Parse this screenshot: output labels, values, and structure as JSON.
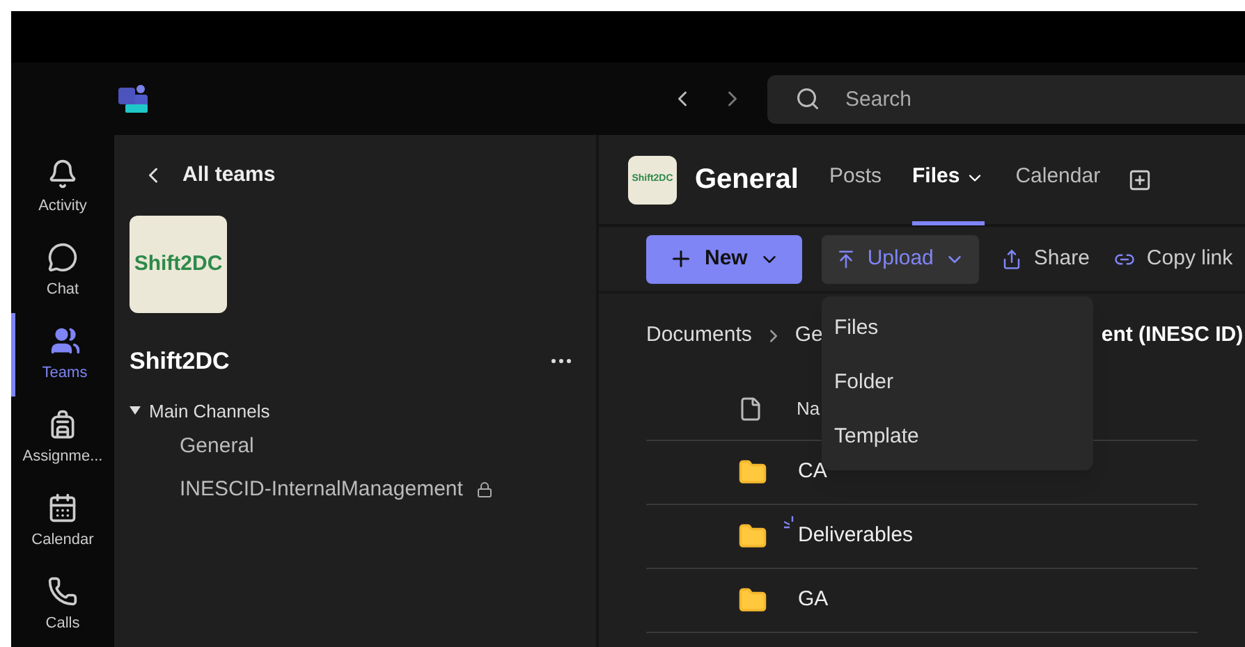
{
  "top_bar": {
    "search": {
      "placeholder": "Search"
    }
  },
  "rail": [
    {
      "label": "Activity",
      "kind": "bell",
      "selected": false
    },
    {
      "label": "Chat",
      "kind": "chat",
      "selected": false
    },
    {
      "label": "Teams",
      "kind": "teams",
      "selected": true
    },
    {
      "label": "Assignme...",
      "kind": "backpack",
      "selected": false
    },
    {
      "label": "Calendar",
      "kind": "calendar",
      "selected": false
    },
    {
      "label": "Calls",
      "kind": "phone",
      "selected": false
    }
  ],
  "team_panel": {
    "back": "All teams",
    "team_name": "Shift2DC",
    "logo_text": "Shift2DC",
    "group": {
      "label": "Main Channels",
      "expanded": true,
      "channels": [
        {
          "name": "General",
          "private": false
        },
        {
          "name": "INESCID-InternalManagement",
          "private": true
        }
      ]
    }
  },
  "channel": {
    "logo_text": "Shift2DC",
    "title": "General",
    "tabs": [
      {
        "label": "Posts",
        "selected": false,
        "dropdown": false
      },
      {
        "label": "Files",
        "selected": true,
        "dropdown": true
      },
      {
        "label": "Calendar",
        "selected": false,
        "dropdown": false
      }
    ]
  },
  "toolbar": [
    {
      "label": "New",
      "kind": "new",
      "selected": false
    },
    {
      "label": "Upload",
      "kind": "upload",
      "selected": true
    },
    {
      "label": "Share",
      "kind": "share",
      "selected": false
    },
    {
      "label": "Copy link",
      "kind": "link",
      "selected": false
    }
  ],
  "breadcrumb": [
    "Documents",
    "Ge",
    "ent (INESC ID)"
  ],
  "upload_menu": [
    "Files",
    "Folder",
    "Template"
  ],
  "files": {
    "column_header": "Na",
    "rows": [
      {
        "name": "CA",
        "syncing": false
      },
      {
        "name": "Deliverables",
        "syncing": true
      },
      {
        "name": "GA",
        "syncing": false
      }
    ]
  }
}
